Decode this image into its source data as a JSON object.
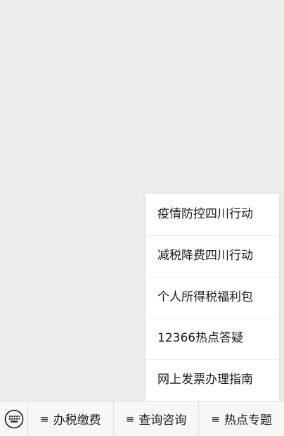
{
  "popup_menu": {
    "items": [
      {
        "label": "疫情防控四川行动"
      },
      {
        "label": "减税降费四川行动"
      },
      {
        "label": "个人所得税福利包"
      },
      {
        "label": "12366热点答疑"
      },
      {
        "label": "网上发票办理指南"
      }
    ]
  },
  "bottom_bar": {
    "keyboard_icon": "keyboard-icon",
    "tabs": [
      {
        "icon": "menu-lines-icon",
        "icon_glyph": "≡",
        "label": "办税缴费"
      },
      {
        "icon": "menu-lines-icon",
        "icon_glyph": "≡",
        "label": "查询咨询"
      },
      {
        "icon": "menu-lines-icon",
        "icon_glyph": "≡",
        "label": "热点专题"
      }
    ]
  },
  "colors": {
    "background": "#ededed",
    "popup_background": "#ffffff",
    "bar_background": "#f7f7f7",
    "text": "#1a1a1a"
  }
}
